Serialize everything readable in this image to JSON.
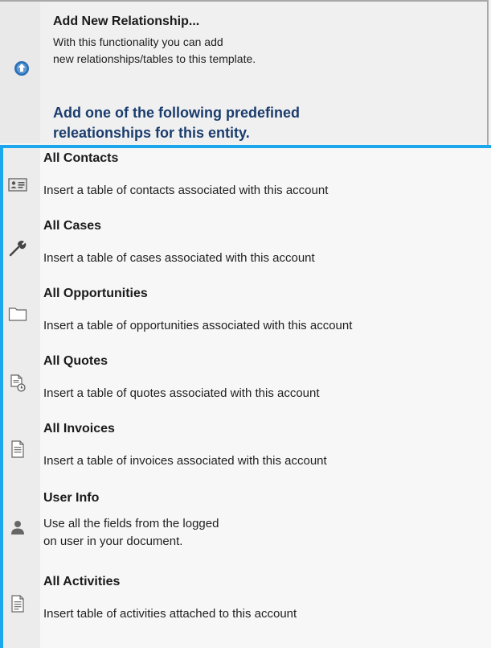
{
  "add_new": {
    "title": "Add New Relationship...",
    "desc_line1": "With this functionality you can add",
    "desc_line2": "new relationships/tables to this template.",
    "icon": "upload-circle-icon"
  },
  "predefined_heading": {
    "line1": "Add one of the following predefined",
    "line2": "releationships for this entity."
  },
  "items": [
    {
      "title": "All Contacts",
      "desc": "Insert a table of contacts associated with this account",
      "icon": "contact-card-icon"
    },
    {
      "title": "All Cases",
      "desc": "Insert a table of cases associated with this account",
      "icon": "wrench-icon"
    },
    {
      "title": "All Opportunities",
      "desc": "Insert a table of opportunities associated with this account",
      "icon": "folder-icon"
    },
    {
      "title": "All Quotes",
      "desc": "Insert a table of quotes associated with this account",
      "icon": "quote-document-icon"
    },
    {
      "title": "All Invoices",
      "desc": "Insert a table of invoices associated with this account",
      "icon": "invoice-document-icon"
    },
    {
      "title": "User Info",
      "desc_line1": "Use all the fields from the logged",
      "desc_line2": "on user in your document.",
      "icon": "user-icon"
    },
    {
      "title": "All Activities",
      "desc": "Insert table of activities attached to this account",
      "icon": "activities-document-icon"
    }
  ],
  "colors": {
    "accent_border": "#1aa7ec",
    "heading_blue": "#1b3d6e",
    "icon_blue": "#2a6fb5"
  }
}
